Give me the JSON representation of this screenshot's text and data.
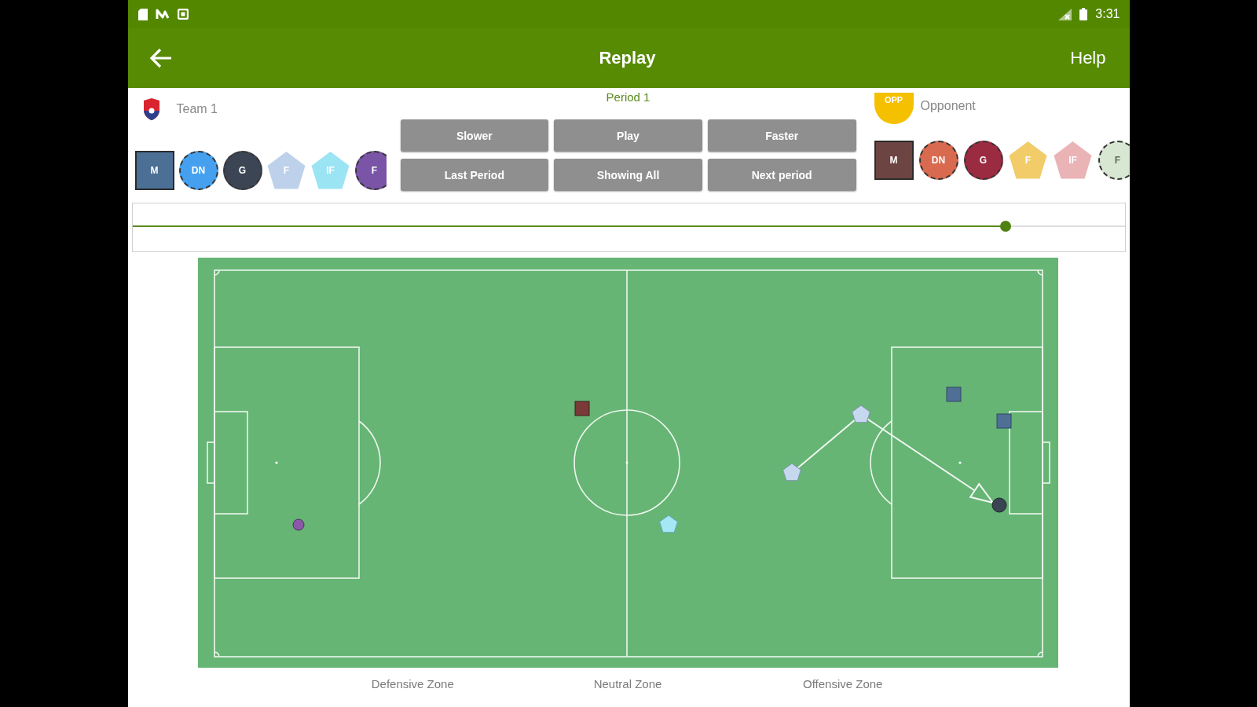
{
  "status_bar": {
    "time": "3:31"
  },
  "app_bar": {
    "title": "Replay",
    "action": "Help"
  },
  "home_team": {
    "name": "Team 1",
    "players": [
      {
        "label": "M",
        "kind": "square",
        "color": "#4b6f95"
      },
      {
        "label": "DN",
        "kind": "circle",
        "color": "#45a1ef"
      },
      {
        "label": "G",
        "kind": "circle",
        "color": "#3c4553"
      },
      {
        "label": "F",
        "kind": "pentagon",
        "color": "#bdd1ea"
      },
      {
        "label": "IF",
        "kind": "pentagon",
        "color": "#9be4f4"
      },
      {
        "label": "F",
        "kind": "circle",
        "color": "#7a54a6"
      }
    ]
  },
  "period": "Period 1",
  "buttons": [
    "Slower",
    "Play",
    "Faster",
    "Last Period",
    "Showing All",
    "Next period"
  ],
  "opponent": {
    "badge": "OPP",
    "name": "Opponent",
    "players": [
      {
        "label": "M",
        "kind": "square",
        "color": "#6c4441"
      },
      {
        "label": "DN",
        "kind": "circle",
        "color": "#d86a50"
      },
      {
        "label": "G",
        "kind": "circle",
        "color": "#9a2b41"
      },
      {
        "label": "F",
        "kind": "pentagon",
        "color": "#f1cc69"
      },
      {
        "label": "IF",
        "kind": "pentagon",
        "color": "#eab3b5"
      },
      {
        "label": "F",
        "kind": "circle",
        "color": "#d7e7d2"
      }
    ]
  },
  "timeline": {
    "level": 0.88
  },
  "zones": [
    "Defensive Zone",
    "Neutral Zone",
    "Offensive Zone"
  ]
}
